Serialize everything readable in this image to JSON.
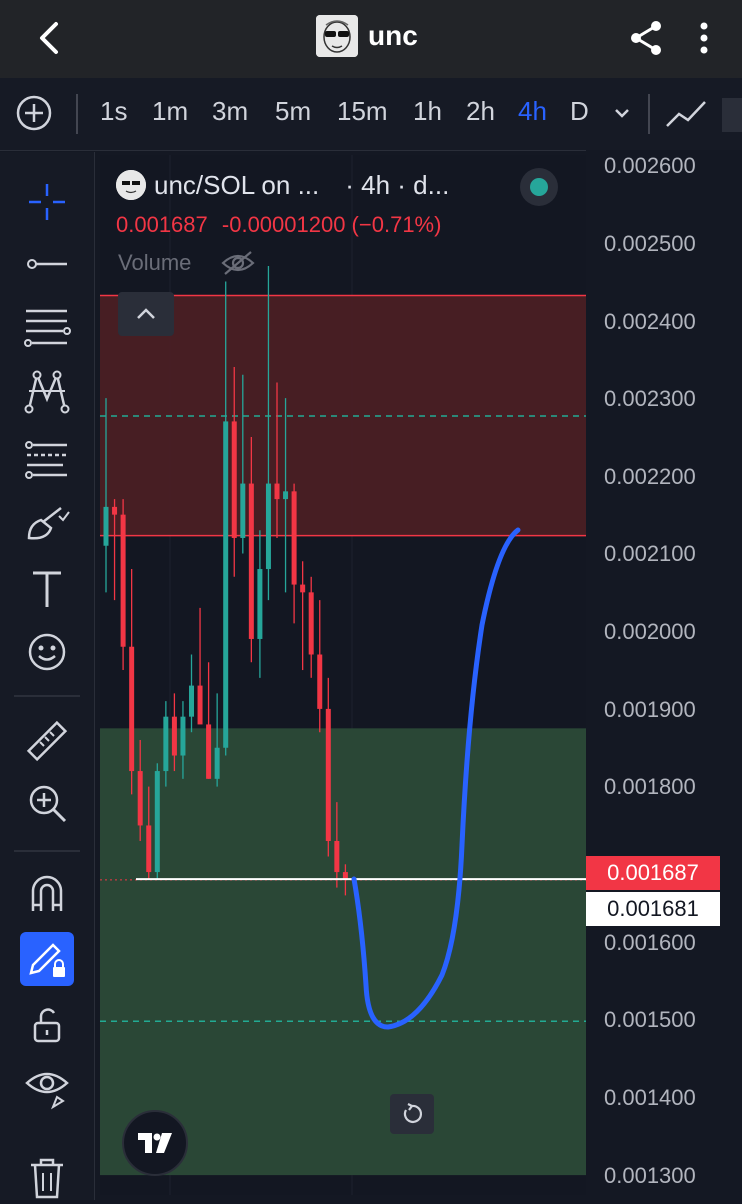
{
  "header": {
    "title": "unc"
  },
  "timeframes": {
    "items": [
      "1s",
      "1m",
      "3m",
      "5m",
      "15m",
      "1h",
      "2h",
      "4h",
      "D"
    ],
    "active": "4h"
  },
  "toolbar_tools": [
    "crosshair-icon",
    "horizontal-line-icon",
    "fib-retracement-icon",
    "pattern-icon",
    "projection-icon",
    "brush-icon",
    "text-tool-icon",
    "emoji-icon",
    "ruler-icon",
    "zoom-in-icon",
    "magnet-icon",
    "lock-drawing-icon",
    "unlock-icon",
    "eye-icon",
    "trash-icon"
  ],
  "legend": {
    "symbol": "unc/SOL on ...",
    "timeframe": "· 4h · d...",
    "price": "0.001687",
    "change": "-0.00001200 (−0.71%)",
    "volume_label": "Volume"
  },
  "price_axis": {
    "ticks": [
      "0.002600",
      "0.002500",
      "0.002400",
      "0.002300",
      "0.002200",
      "0.002100",
      "0.002000",
      "0.001900",
      "0.001800",
      "0.001600",
      "0.001500",
      "0.001400",
      "0.001300"
    ],
    "last_price": "0.001687",
    "crosshair_price": "0.001681"
  },
  "colors": {
    "up": "#26a69a",
    "down": "#f23645",
    "accent": "#2962ff",
    "zone_red": "#4a1f24",
    "zone_green": "#2b4a38",
    "drawing": "#2962ff",
    "dashed_level": "#22ab94"
  },
  "chart_data": {
    "type": "candlestick",
    "pair": "unc/SOL",
    "interval": "4h",
    "ylim": [
      0.0013,
      0.0026
    ],
    "candles": [
      {
        "o": 0.00211,
        "h": 0.0023,
        "l": 0.00205,
        "c": 0.00216
      },
      {
        "o": 0.00216,
        "h": 0.00217,
        "l": 0.00204,
        "c": 0.00215
      },
      {
        "o": 0.00215,
        "h": 0.00217,
        "l": 0.00195,
        "c": 0.00198
      },
      {
        "o": 0.00198,
        "h": 0.00208,
        "l": 0.00179,
        "c": 0.00182
      },
      {
        "o": 0.00182,
        "h": 0.00186,
        "l": 0.00173,
        "c": 0.00175
      },
      {
        "o": 0.00175,
        "h": 0.0018,
        "l": 0.00168,
        "c": 0.00169
      },
      {
        "o": 0.00169,
        "h": 0.00183,
        "l": 0.00168,
        "c": 0.00182
      },
      {
        "o": 0.00182,
        "h": 0.00191,
        "l": 0.0018,
        "c": 0.00189
      },
      {
        "o": 0.00189,
        "h": 0.00192,
        "l": 0.00182,
        "c": 0.00184
      },
      {
        "o": 0.00184,
        "h": 0.00191,
        "l": 0.00181,
        "c": 0.00189
      },
      {
        "o": 0.00189,
        "h": 0.00197,
        "l": 0.00187,
        "c": 0.00193
      },
      {
        "o": 0.00193,
        "h": 0.00203,
        "l": 0.00189,
        "c": 0.00188
      },
      {
        "o": 0.00188,
        "h": 0.00196,
        "l": 0.00181,
        "c": 0.00181
      },
      {
        "o": 0.00181,
        "h": 0.00192,
        "l": 0.0018,
        "c": 0.00185
      },
      {
        "o": 0.00185,
        "h": 0.00245,
        "l": 0.00184,
        "c": 0.00227
      },
      {
        "o": 0.00227,
        "h": 0.00234,
        "l": 0.00207,
        "c": 0.00212
      },
      {
        "o": 0.00212,
        "h": 0.00233,
        "l": 0.0021,
        "c": 0.00219
      },
      {
        "o": 0.00219,
        "h": 0.00225,
        "l": 0.00196,
        "c": 0.00199
      },
      {
        "o": 0.00199,
        "h": 0.00213,
        "l": 0.00194,
        "c": 0.00208
      },
      {
        "o": 0.00208,
        "h": 0.00247,
        "l": 0.00204,
        "c": 0.00219
      },
      {
        "o": 0.00219,
        "h": 0.00232,
        "l": 0.00212,
        "c": 0.00217
      },
      {
        "o": 0.00217,
        "h": 0.0023,
        "l": 0.00205,
        "c": 0.00218
      },
      {
        "o": 0.00218,
        "h": 0.00219,
        "l": 0.00201,
        "c": 0.00206
      },
      {
        "o": 0.00206,
        "h": 0.00209,
        "l": 0.00195,
        "c": 0.00205
      },
      {
        "o": 0.00205,
        "h": 0.00207,
        "l": 0.00194,
        "c": 0.00197
      },
      {
        "o": 0.00197,
        "h": 0.00204,
        "l": 0.00187,
        "c": 0.0019
      },
      {
        "o": 0.0019,
        "h": 0.00194,
        "l": 0.00171,
        "c": 0.00173
      },
      {
        "o": 0.00173,
        "h": 0.00178,
        "l": 0.00167,
        "c": 0.00169
      },
      {
        "o": 0.00169,
        "h": 0.0017,
        "l": 0.00166,
        "c": 0.00168
      }
    ],
    "zones": [
      {
        "type": "resistance",
        "from": 0.002123,
        "to": 0.002432
      },
      {
        "type": "support",
        "from": 0.0013,
        "to": 0.001875
      }
    ],
    "dashed_levels": [
      0.002277,
      0.001498
    ],
    "price_lines": [
      0.001681
    ]
  }
}
